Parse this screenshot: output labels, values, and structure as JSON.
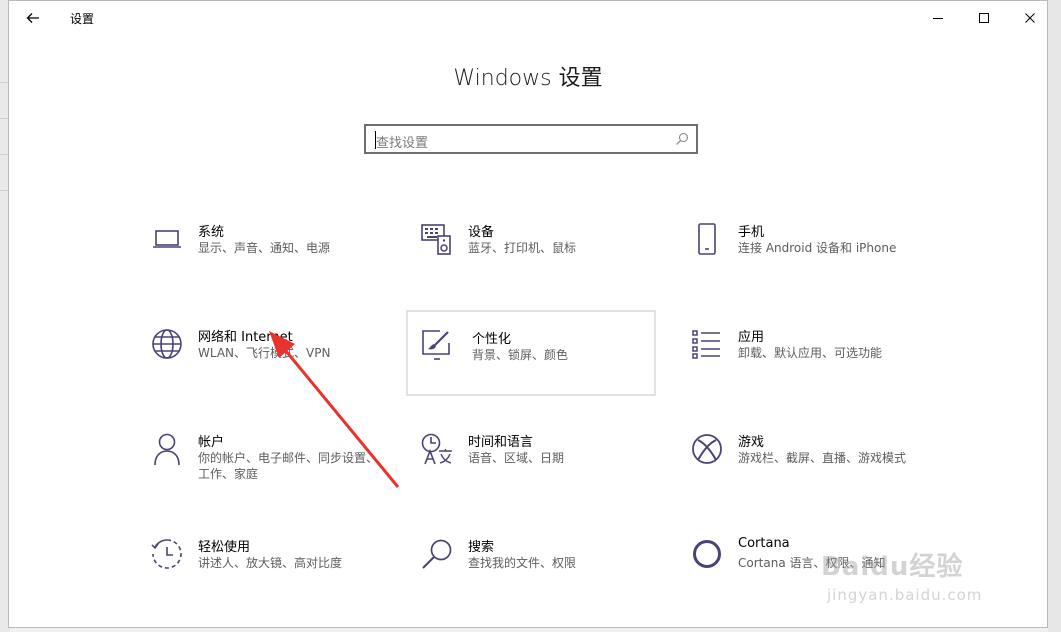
{
  "window": {
    "title": "设置",
    "back_icon": "arrow-left-icon",
    "controls": [
      "minimize-icon",
      "maximize-icon",
      "close-icon"
    ]
  },
  "main": {
    "heading": "Windows 设置",
    "search": {
      "placeholder": "查找设置",
      "icon": "search-icon"
    },
    "tiles": [
      {
        "title": "系统",
        "desc": "显示、声音、通知、电源",
        "icon": "laptop-icon"
      },
      {
        "title": "设备",
        "desc": "蓝牙、打印机、鼠标",
        "icon": "keyboard-speaker-icon"
      },
      {
        "title": "手机",
        "desc": "连接 Android 设备和 iPhone",
        "icon": "phone-icon"
      },
      {
        "title": "网络和 Internet",
        "desc": "WLAN、飞行模式、VPN",
        "icon": "globe-icon"
      },
      {
        "title": "个性化",
        "desc": "背景、锁屏、颜色",
        "icon": "paint-brush-icon"
      },
      {
        "title": "应用",
        "desc": "卸载、默认应用、可选功能",
        "icon": "app-list-icon"
      },
      {
        "title": "帐户",
        "desc": "你的帐户、电子邮件、同步设置、工作、家庭",
        "icon": "person-icon"
      },
      {
        "title": "时间和语言",
        "desc": "语音、区域、日期",
        "icon": "time-language-icon"
      },
      {
        "title": "游戏",
        "desc": "游戏栏、截屏、直播、游戏模式",
        "icon": "xbox-icon"
      },
      {
        "title": "轻松使用",
        "desc": "讲述人、放大镜、高对比度",
        "icon": "ease-of-access-icon"
      },
      {
        "title": "搜索",
        "desc": "查找我的文件、权限",
        "icon": "magnifier-icon"
      },
      {
        "title": "Cortana",
        "desc": "Cortana 语言、权限、通知",
        "icon": "cortana-icon"
      }
    ]
  },
  "watermark": {
    "main": "Baidu经验",
    "sub": "jingyan.baidu.com"
  },
  "colors": {
    "accent": "#4b4376",
    "arrow": "#e8322d"
  }
}
